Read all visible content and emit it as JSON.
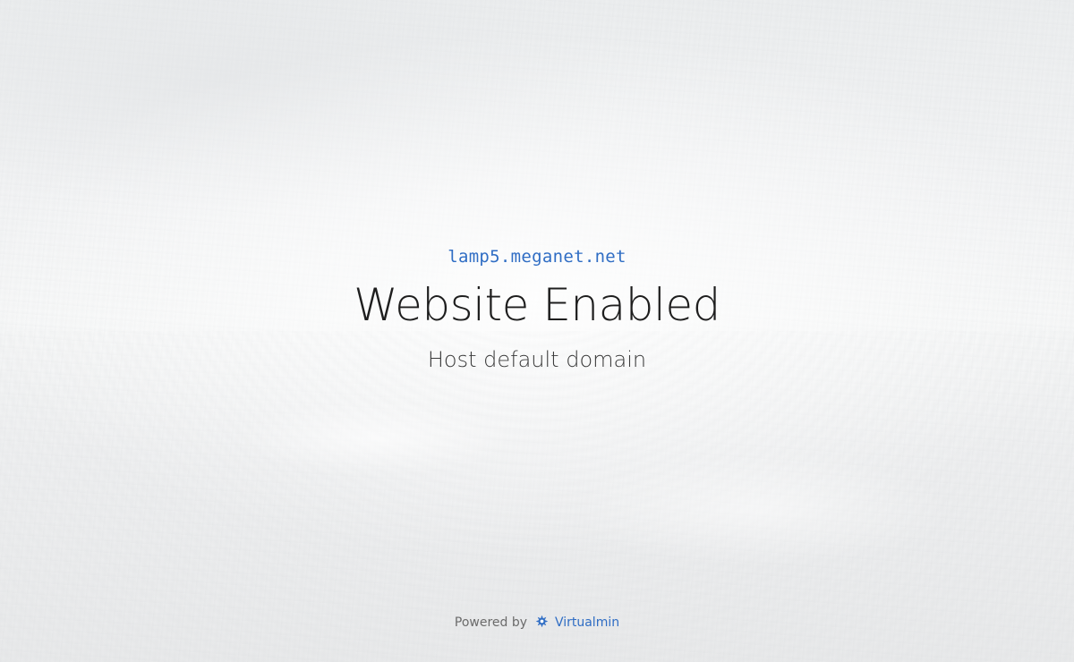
{
  "page": {
    "domain": "lamp5.meganet.net",
    "title": "Website Enabled",
    "subtitle": "Host default domain"
  },
  "footer": {
    "powered_by": "Powered by",
    "brand": "Virtualmin",
    "brand_icon": "virtualmin-logo-icon"
  },
  "colors": {
    "link": "#2f6dc4",
    "title": "#1e1e1e",
    "footer_text": "#6b6b6b"
  }
}
